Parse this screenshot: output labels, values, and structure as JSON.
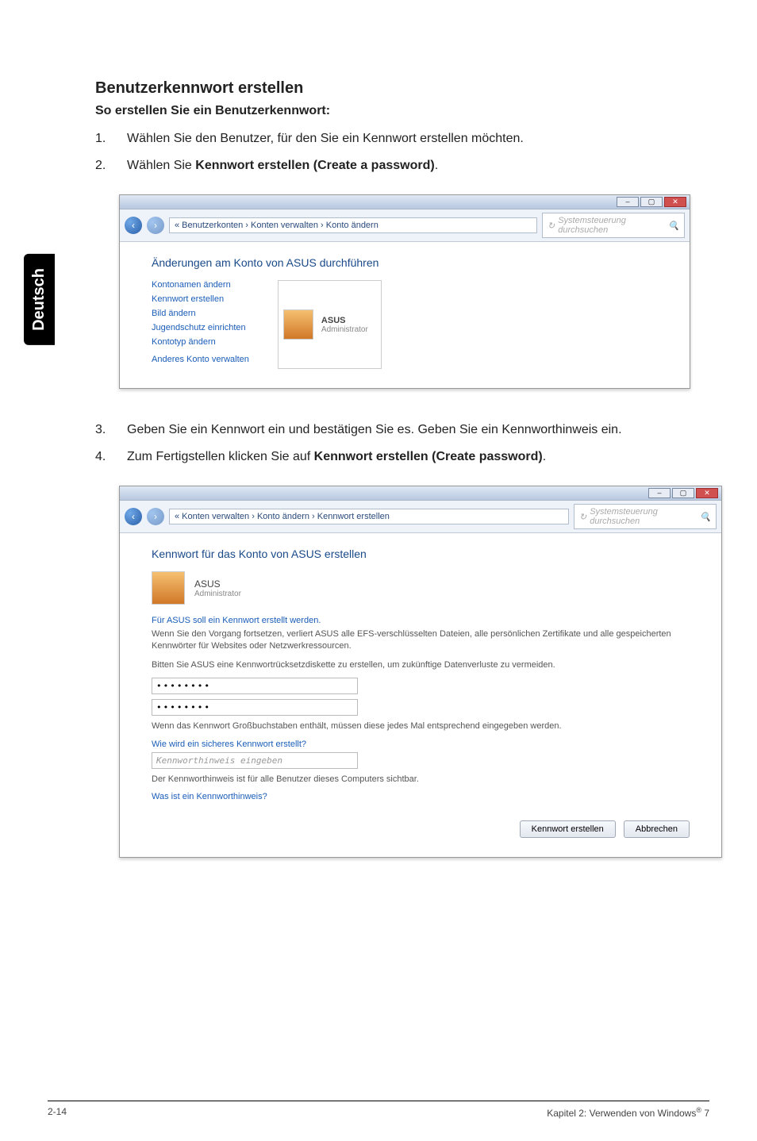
{
  "sidetab": "Deutsch",
  "title": "Benutzerkennwort erstellen",
  "subhead": "So erstellen Sie ein Benutzerkennwort:",
  "step1": {
    "num": "1.",
    "text": "Wählen Sie den Benutzer, für den Sie ein Kennwort erstellen möchten."
  },
  "step2": {
    "num": "2.",
    "prefix": "Wählen Sie ",
    "bold": "Kennwort erstellen (Create a password)",
    "suffix": "."
  },
  "step3": {
    "num": "3.",
    "text": "Geben Sie ein Kennwort ein und bestätigen Sie es. Geben Sie ein Kennworthinweis ein."
  },
  "step4": {
    "num": "4.",
    "prefix": "Zum Fertigstellen klicken Sie auf ",
    "bold": "Kennwort erstellen (Create password)",
    "suffix": "."
  },
  "win1": {
    "breadcrumb": "« Benutzerkonten  ›  Konten verwalten  ›  Konto ändern",
    "searchph": "Systemsteuerung durchsuchen",
    "heading": "Änderungen am Konto von ASUS durchführen",
    "links": {
      "a": "Kontonamen ändern",
      "b": "Kennwort erstellen",
      "c": "Bild ändern",
      "d": "Jugendschutz einrichten",
      "e": "Kontotyp ändern",
      "f": "Anderes Konto verwalten"
    },
    "user": {
      "name": "ASUS",
      "role": "Administrator"
    }
  },
  "win2": {
    "breadcrumb": "« Konten verwalten  ›  Konto ändern  ›  Kennwort erstellen",
    "searchph": "Systemsteuerung durchsuchen",
    "heading": "Kennwort für das Konto von ASUS erstellen",
    "user": {
      "name": "ASUS",
      "role": "Administrator"
    },
    "note_blue1": "Für ASUS soll ein Kennwort erstellt werden.",
    "note_gray1": "Wenn Sie den Vorgang fortsetzen, verliert ASUS alle EFS-verschlüsselten Dateien, alle persönlichen Zertifikate und alle gespeicherten Kennwörter für Websites oder Netzwerkressourcen.",
    "note_gray2": "Bitten Sie ASUS eine Kennwortrücksetzdiskette zu erstellen, um zukünftige Datenverluste zu vermeiden.",
    "pwmask": "••••••••",
    "note_gray3": "Wenn das Kennwort Großbuchstaben enthält, müssen diese jedes Mal entsprechend eingegeben werden.",
    "link_help1": "Wie wird ein sicheres Kennwort erstellt?",
    "hint_ph": "Kennworthinweis eingeben",
    "note_gray4": "Der Kennworthinweis ist für alle Benutzer dieses Computers sichtbar.",
    "link_help2": "Was ist ein Kennworthinweis?",
    "btn_create": "Kennwort erstellen",
    "btn_cancel": "Abbrechen"
  },
  "footer": {
    "left": "2-14",
    "right_prefix": "Kapitel 2: Verwenden von Windows",
    "right_sup": "®",
    "right_suffix": " 7"
  }
}
